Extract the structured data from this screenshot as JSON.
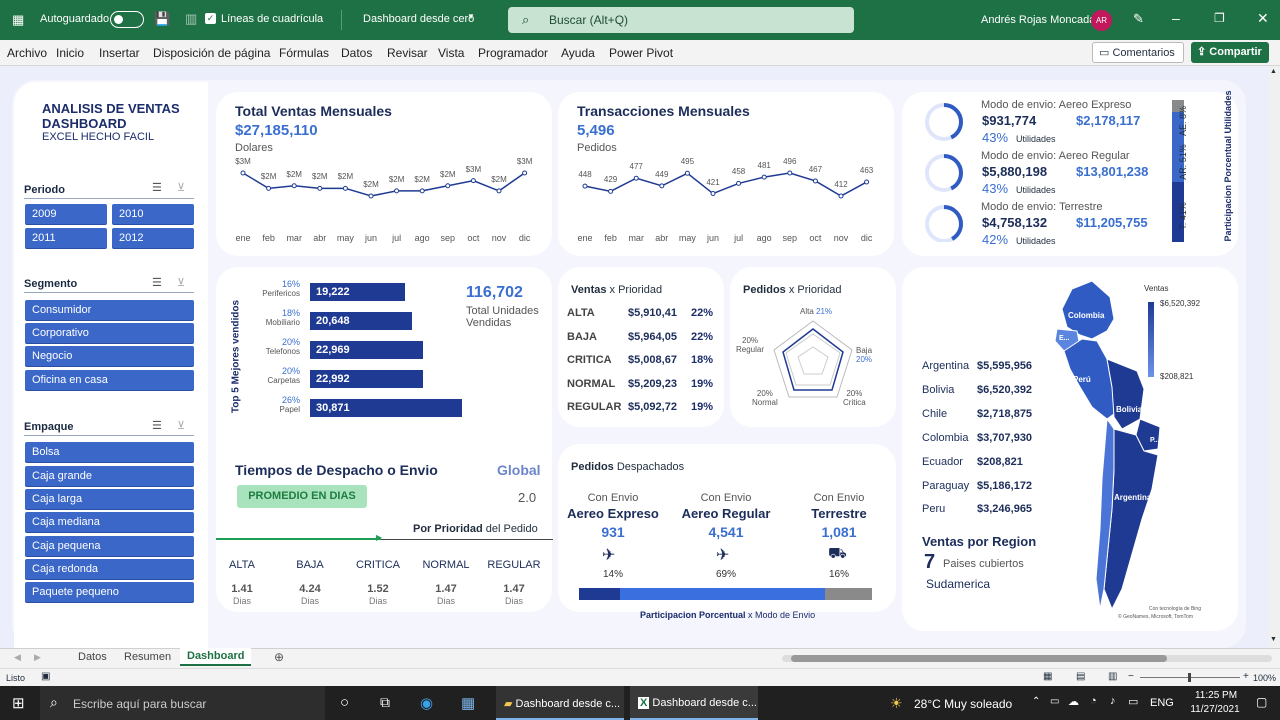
{
  "titlebar": {
    "autosave": "Autoguardado",
    "gridlines": "Líneas de cuadrícula",
    "file": "Dashboard desde cero",
    "search": "Buscar (Alt+Q)",
    "user": "Andrés Rojas Moncada",
    "initials": "AR"
  },
  "menu": [
    "Archivo",
    "Inicio",
    "Insertar",
    "Disposición de página",
    "Fórmulas",
    "Datos",
    "Revisar",
    "Vista",
    "Programador",
    "Ayuda",
    "Power Pivot"
  ],
  "comments": "Comentarios",
  "share": "Compartir",
  "header": {
    "title1": "ANALISIS DE VENTAS",
    "title2": "DASHBOARD",
    "subtitle": "EXCEL HECHO FACIL"
  },
  "slicers": {
    "periodo": {
      "title": "Periodo",
      "items": [
        "2009",
        "2010",
        "2011",
        "2012"
      ]
    },
    "segmento": {
      "title": "Segmento",
      "items": [
        "Consumidor",
        "Corporativo",
        "Negocio",
        "Oficina en casa"
      ]
    },
    "empaque": {
      "title": "Empaque",
      "items": [
        "Bolsa",
        "Caja grande",
        "Caja larga",
        "Caja mediana",
        "Caja pequena",
        "Caja redonda",
        "Paquete pequeno"
      ]
    }
  },
  "ventas": {
    "title": "Total Ventas Mensuales",
    "total": "$27,185,110",
    "unit": "Dolares",
    "labels": [
      "$3M",
      "$2M",
      "$2M",
      "$2M",
      "$2M",
      "$2M",
      "$2M",
      "$2M",
      "$2M",
      "$3M",
      "$2M",
      "$3M"
    ],
    "values": [
      3.0,
      2.4,
      2.5,
      2.4,
      2.4,
      2.1,
      2.3,
      2.3,
      2.5,
      2.7,
      2.3,
      3.0
    ]
  },
  "months": [
    "ene",
    "feb",
    "mar",
    "abr",
    "may",
    "jun",
    "jul",
    "ago",
    "sep",
    "oct",
    "nov",
    "dic"
  ],
  "trans": {
    "title": "Transacciones Mensuales",
    "total": "5,496",
    "unit": "Pedidos",
    "labels": [
      "448",
      "429",
      "477",
      "449",
      "495",
      "421",
      "458",
      "481",
      "496",
      "467",
      "412",
      "463"
    ],
    "values": [
      448,
      429,
      477,
      449,
      495,
      421,
      458,
      481,
      496,
      467,
      412,
      463
    ]
  },
  "modo": [
    {
      "name": "Modo de envio: Aereo Expreso",
      "util": "$931,774",
      "ventas": "$2,178,117",
      "pct": "43%",
      "ul": "Utilidades"
    },
    {
      "name": "Modo de envio: Aereo Regular",
      "util": "$5,880,198",
      "ventas": "$13,801,238",
      "pct": "43%",
      "ul": "Utilidades"
    },
    {
      "name": "Modo de envio: Terrestre",
      "util": "$4,758,132",
      "ventas": "$11,205,755",
      "pct": "42%",
      "ul": "Utilidades"
    }
  ],
  "part": {
    "title": "Participacion Porcentual Utilidades",
    "ae": "AE: 8%",
    "ar": "AR: 51%",
    "t": "T: 41%"
  },
  "top5": {
    "title": "Top 5 Mejores vendidos",
    "items": [
      {
        "pct": "16%",
        "name": "Perifericos",
        "val": "19,222",
        "n": 19222
      },
      {
        "pct": "18%",
        "name": "Mobiliario",
        "val": "20,648",
        "n": 20648
      },
      {
        "pct": "20%",
        "name": "Telefonos",
        "val": "22,969",
        "n": 22969
      },
      {
        "pct": "20%",
        "name": "Carpetas",
        "val": "22,992",
        "n": 22992
      },
      {
        "pct": "26%",
        "name": "Papel",
        "val": "30,871",
        "n": 30871
      }
    ],
    "total": "116,702",
    "totlbl1": "Total Unidades",
    "totlbl2": "Vendidas"
  },
  "vxp": {
    "t1": "Ventas",
    "t2": " x Prioridad",
    "rows": [
      {
        "k": "ALTA",
        "v": "$5,910,41",
        "p": "22%"
      },
      {
        "k": "BAJA",
        "v": "$5,964,05",
        "p": "22%"
      },
      {
        "k": "CRITICA",
        "v": "$5,008,67",
        "p": "18%"
      },
      {
        "k": "NORMAL",
        "v": "$5,209,23",
        "p": "19%"
      },
      {
        "k": "REGULAR",
        "v": "$5,092,72",
        "p": "19%"
      }
    ]
  },
  "pxp": {
    "t1": "Pedidos",
    "t2": " x Prioridad",
    "alta": "Alta",
    "altap": "21%",
    "baja": "Baja",
    "bajap": "20%",
    "critica": "Critica",
    "criticap": "20%",
    "normal": "Normal",
    "normalp": "20%",
    "regular": "Regular",
    "regularp": "20%"
  },
  "mapa": {
    "legend": "Ventas",
    "max": "$6,520,392",
    "min": "$208,821",
    "rows": [
      {
        "k": "Argentina",
        "v": "$5,595,956"
      },
      {
        "k": "Bolivia",
        "v": "$6,520,392"
      },
      {
        "k": "Chile",
        "v": "$2,718,875"
      },
      {
        "k": "Colombia",
        "v": "$3,707,930"
      },
      {
        "k": "Ecuador",
        "v": "$208,821"
      },
      {
        "k": "Paraguay",
        "v": "$5,186,172"
      },
      {
        "k": "Peru",
        "v": "$3,246,965"
      }
    ],
    "title": "Ventas por Region",
    "count": "7",
    "paises": "Paises cubiertos",
    "region": "Sudamerica",
    "labels": {
      "colombia": "Colombia",
      "ecuador": "E...",
      "peru": "Perú",
      "bolivia": "Bolivia",
      "paraguay": "P...",
      "argentina": "Argentina"
    },
    "credit1": "Con tecnología de Bing",
    "credit2": "© GeoNames, Microsoft, TomTom"
  },
  "despacho": {
    "title": "Tiempos de Despacho o Envio",
    "global": "Global",
    "badge": "PROMEDIO EN DIAS",
    "gval": "2.0",
    "por": "Por Prioridad",
    "del": " del Pedido",
    "cols": [
      {
        "k": "ALTA",
        "v": "1.41"
      },
      {
        "k": "BAJA",
        "v": "4.24"
      },
      {
        "k": "CRITICA",
        "v": "1.52"
      },
      {
        "k": "NORMAL",
        "v": "1.47"
      },
      {
        "k": "REGULAR",
        "v": "1.47"
      }
    ],
    "dias": "Dias"
  },
  "despachados": {
    "t1": "Pedidos",
    "t2": " Despachados",
    "cols": [
      {
        "a": "Con Envio",
        "b": "Aereo Expreso",
        "c": "931",
        "p": "14%"
      },
      {
        "a": "Con Envio",
        "b": "Aereo Regular",
        "c": "4,541",
        "p": "69%"
      },
      {
        "a": "Con Envio",
        "b": "Terrestre",
        "c": "1,081",
        "p": "16%"
      }
    ],
    "foot1": "Participacion Porcentual",
    "foot2": " x Modo de Envio"
  },
  "tabs": [
    "Datos",
    "Resumen",
    "Dashboard"
  ],
  "status": {
    "ready": "Listo",
    "zoom": "100%"
  },
  "taskbar": {
    "search": "Escribe aquí para buscar",
    "app1": "Dashboard desde c...",
    "app2": "Dashboard desde c...",
    "weather": "28°C  Muy soleado",
    "lang": "ENG",
    "time": "11:25 PM",
    "date": "11/27/2021"
  }
}
